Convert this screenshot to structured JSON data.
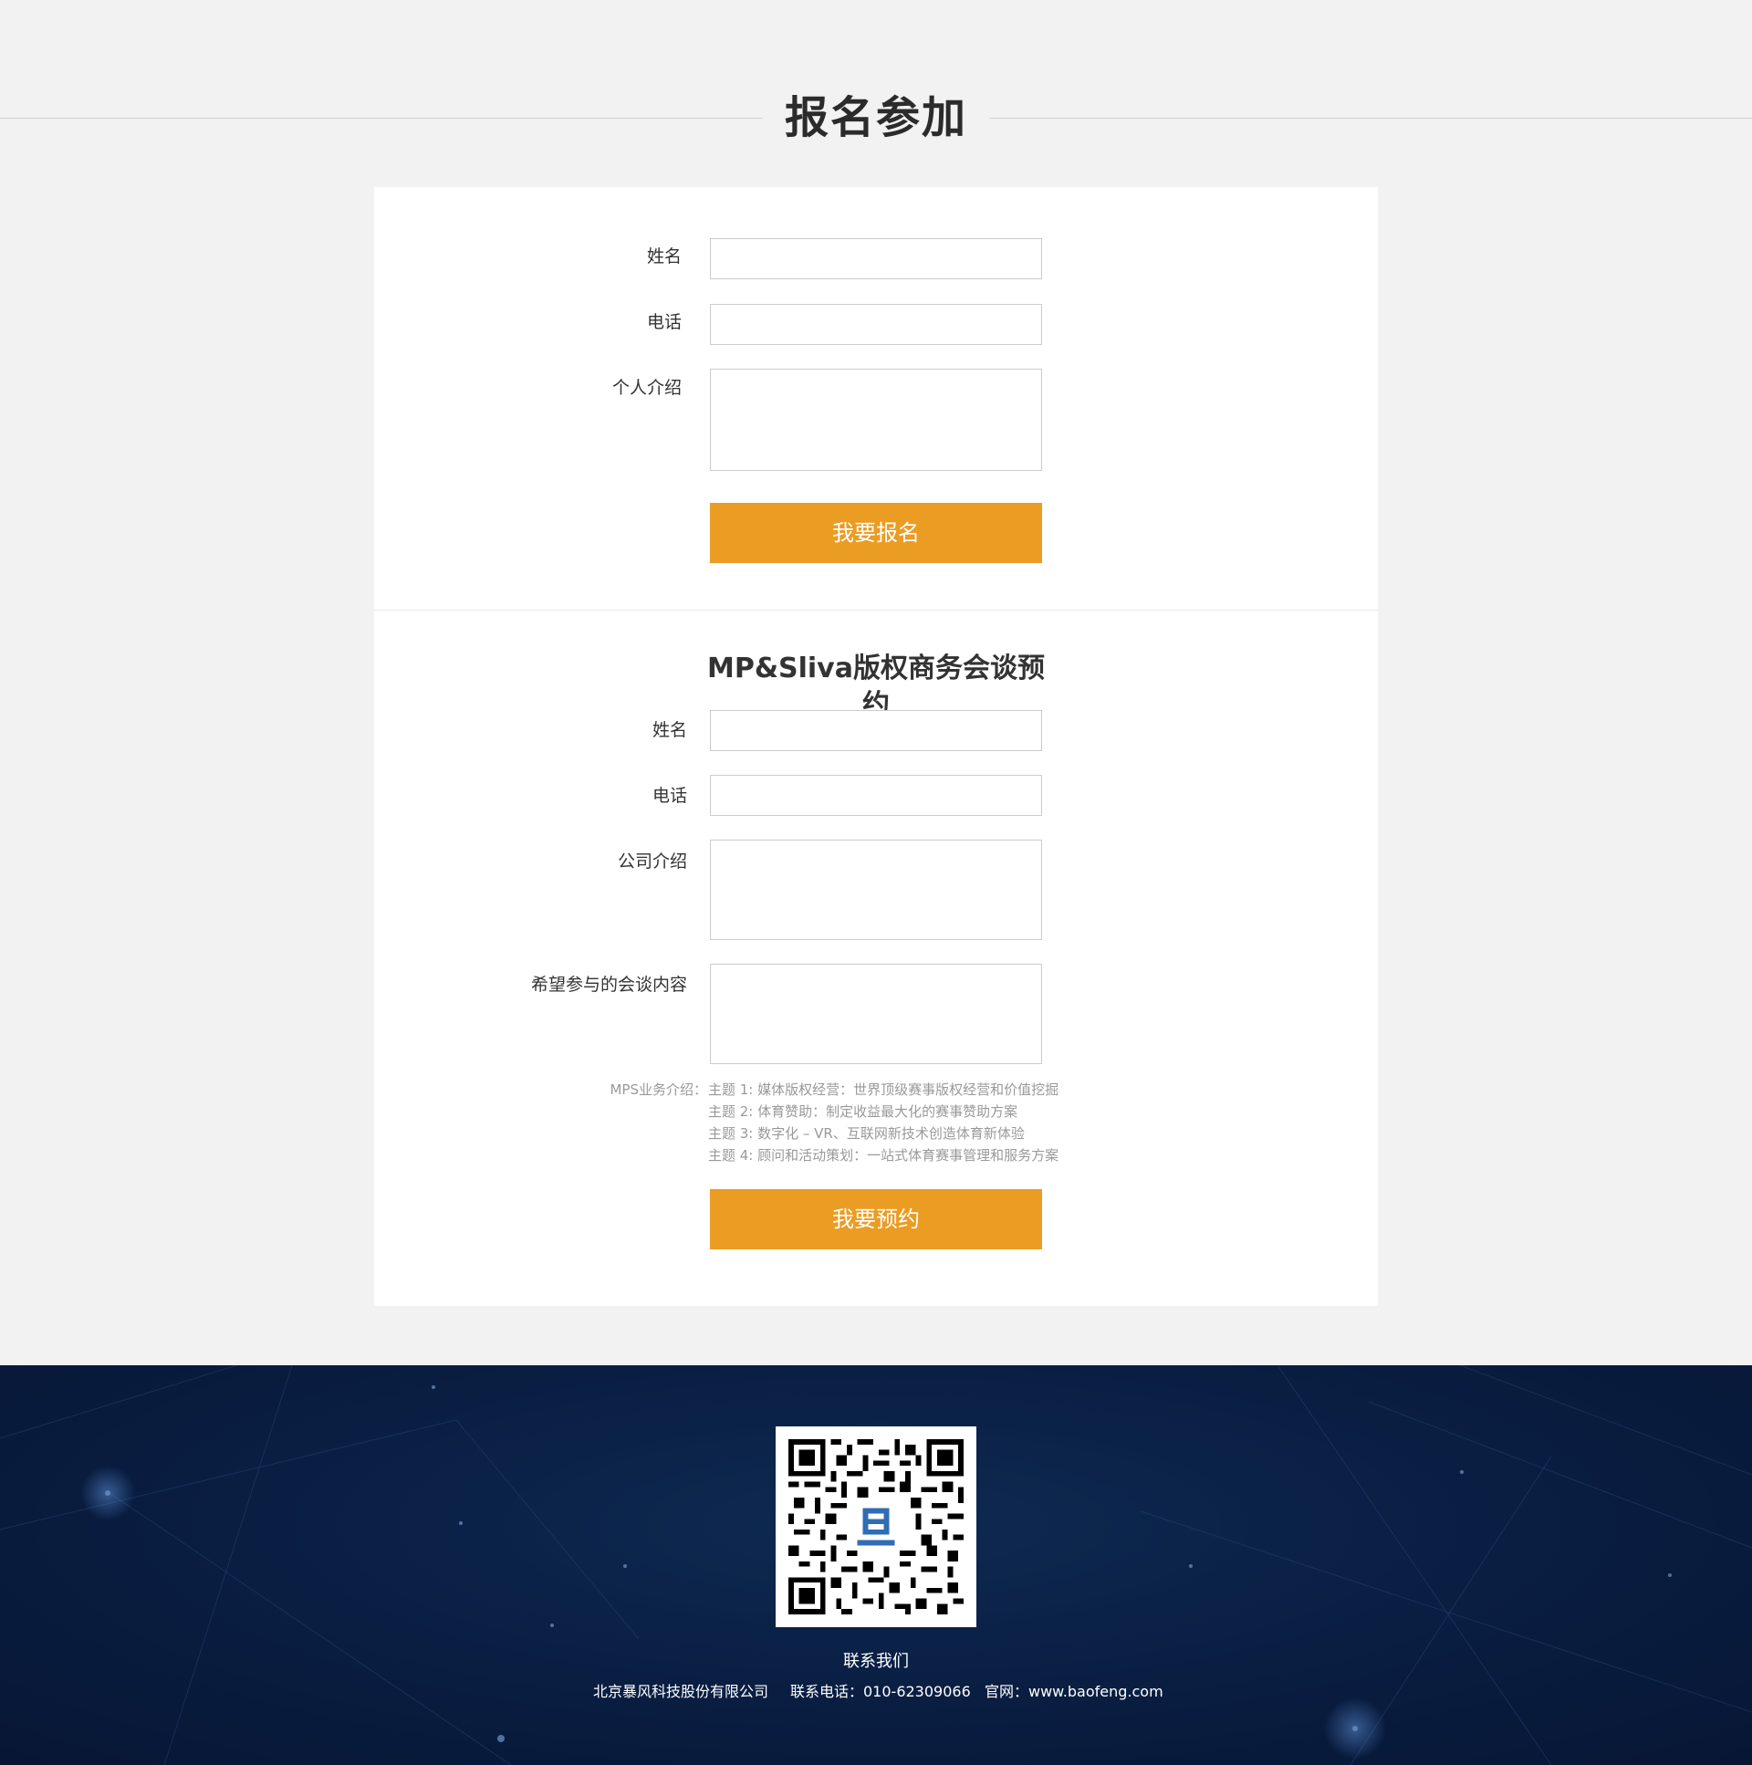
{
  "header": {
    "title": "报名参加"
  },
  "signup": {
    "name_label": "姓名",
    "phone_label": "电话",
    "intro_label": "个人介绍",
    "name_value": "",
    "phone_value": "",
    "intro_value": "",
    "submit_label": "我要报名"
  },
  "meeting": {
    "title": "MP&Sliva版权商务会谈预约",
    "name_label": "姓名",
    "phone_label": "电话",
    "company_label": "公司介绍",
    "content_label": "希望参与的会谈内容",
    "name_value": "",
    "phone_value": "",
    "company_value": "",
    "content_value": "",
    "mps_label": "MPS业务介绍：",
    "topics": [
      "主题 1:  媒体版权经营：世界顶级赛事版权经营和价值挖掘",
      "主题 2: 体育赞助：制定收益最大化的赛事赞助方案",
      "主题 3: 数字化 – VR、互联网新技术创造体育新体验",
      "主题 4: 顾问和活动策划：一站式体育赛事管理和服务方案"
    ],
    "submit_label": "我要预约"
  },
  "footer": {
    "qr_icon": "qr-code-icon",
    "contact_title": "联系我们",
    "company": "北京暴风科技股份有限公司",
    "phone": "联系电话：010-62309066",
    "website": "官网：www.baofeng.com"
  },
  "colors": {
    "accent": "#eb9c22",
    "page_bg": "#f2f2f2",
    "footer_bg": "#0a1f44"
  }
}
